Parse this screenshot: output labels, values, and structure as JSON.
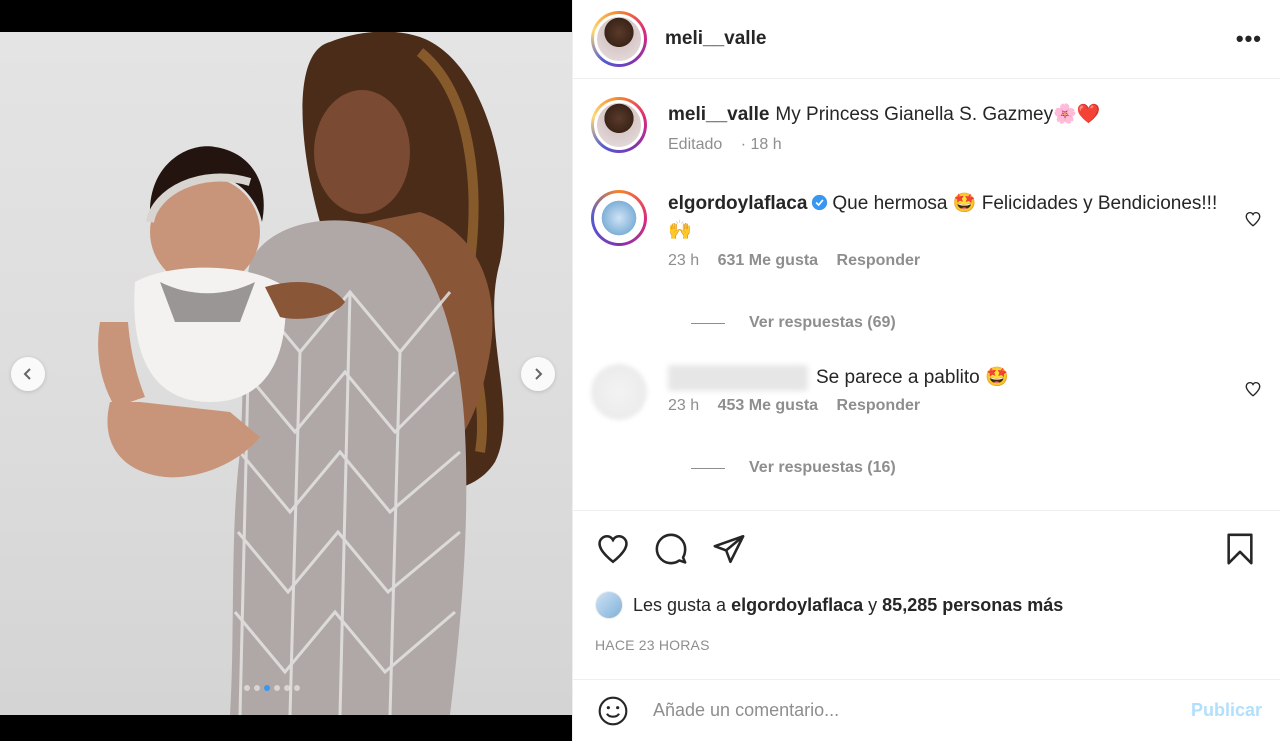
{
  "post": {
    "username": "meli__valle",
    "more_label": "•••",
    "caption_text": "My Princess Gianella S. Gazmey🌸❤️",
    "caption_edited": "Editado",
    "caption_time": "18 h"
  },
  "comments": [
    {
      "username": "elgordoylaflaca",
      "verified": true,
      "text": "Que hermosa 🤩 Felicidades y Bendiciones!!! 🙌",
      "time": "23 h",
      "likes": "631 Me gusta",
      "reply_label": "Responder",
      "view_replies": "Ver respuestas (69)"
    },
    {
      "username": "",
      "text": "Se parece a pablito 🤩",
      "time": "23 h",
      "likes": "453 Me gusta",
      "reply_label": "Responder",
      "view_replies": "Ver respuestas (16)"
    }
  ],
  "likes_summary": {
    "prefix": "Les gusta a",
    "user": "elgordoylaflaca",
    "middle": "y",
    "count": "85,285 personas más"
  },
  "timestamp": "HACE 23 HORAS",
  "add_comment": {
    "placeholder": "Añade un comentario...",
    "publish_label": "Publicar"
  },
  "carousel": {
    "total_slides": 6,
    "active_index": 2
  }
}
